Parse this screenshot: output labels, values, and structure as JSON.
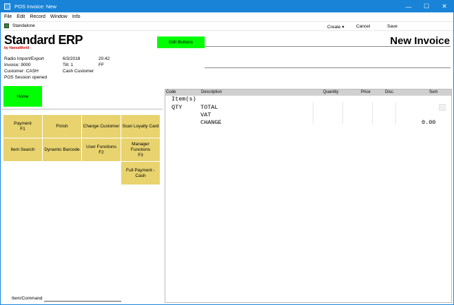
{
  "window": {
    "title": "POS Invoice: New",
    "minimize": "—",
    "maximize": "☐",
    "close": "✕"
  },
  "menu": [
    "File",
    "Edit",
    "Record",
    "Window",
    "Info"
  ],
  "toolbar": {
    "standalone": "Standalone",
    "create": "Create",
    "create_arrow": "▾",
    "cancel": "Cancel",
    "save": "Save"
  },
  "header": {
    "logo": "Standard ERP",
    "logo_sub": "by HansaWorld",
    "edit_buttons": "Edit Buttons",
    "page_title": "New Invoice"
  },
  "info": {
    "company": "Radio Import/Export",
    "date": "6/3/2018",
    "time": "20:42",
    "invoice": "Invoice: 9000",
    "till": "Till: 1",
    "till_code": "FF",
    "customer": "Customer: CASH",
    "customer_name": "Cash Customer",
    "session": "POS Session opened"
  },
  "home_button": "Home",
  "buttons": [
    {
      "label": "Payment\nF1",
      "name": "payment-button"
    },
    {
      "label": "Finish",
      "name": "finish-button"
    },
    {
      "label": "Change Customer",
      "name": "change-customer-button"
    },
    {
      "label": "Scan Loyalty Card",
      "name": "scan-loyalty-card-button"
    },
    {
      "label": "Item Search",
      "name": "item-search-button"
    },
    {
      "label": "Dynamic Barcode",
      "name": "dynamic-barcode-button"
    },
    {
      "label": "User Functions\nF2",
      "name": "user-functions-button"
    },
    {
      "label": "Manager\nFunctions\nF3",
      "name": "manager-functions-button"
    },
    {
      "label": "Full Payment -\nCash",
      "name": "full-payment-cash-button"
    }
  ],
  "table": {
    "columns": [
      "Code",
      "Description",
      "Quantity",
      "Price",
      "Disc.",
      "Sum"
    ],
    "items_label": "Item(s)",
    "qty_label": "QTY",
    "total_label": "TOTAL",
    "vat_label": "VAT",
    "change_label": "CHANGE",
    "change_value": "0.00"
  },
  "item_command": "Item/Command"
}
